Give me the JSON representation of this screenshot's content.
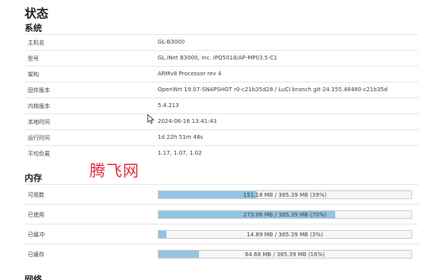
{
  "page_title": "状态",
  "system": {
    "title": "系统",
    "rows": [
      {
        "label": "主机名",
        "value": "GL-B3000"
      },
      {
        "label": "型号",
        "value": "GL.iNet B3000, Inc. IPQ5018/AP-MP03.5-C1"
      },
      {
        "label": "架构",
        "value": "ARMv8 Processor rev 4"
      },
      {
        "label": "固件版本",
        "value": "OpenWrt 19.07-SNAPSHOT r0-c21b35d28 / LuCI branch git-24.155.48480-c21b35d"
      },
      {
        "label": "内核版本",
        "value": "5.4.213"
      },
      {
        "label": "本地时间",
        "value": "2024-06-16 13:41:43"
      },
      {
        "label": "运行时间",
        "value": "1d 22h 51m 48s"
      },
      {
        "label": "平均负载",
        "value": "1.17, 1.07, 1.02"
      }
    ]
  },
  "memory": {
    "title": "内存",
    "rows": [
      {
        "label": "可用数",
        "value": "151.18 MB / 385.39 MB (39%)",
        "fraction": 0.39
      },
      {
        "label": "已使用",
        "value": "273.06 MB / 385.39 MB (70%)",
        "fraction": 0.7
      },
      {
        "label": "已缓冲",
        "value": "14.89 MB / 385.39 MB (3%)",
        "fraction": 0.03
      },
      {
        "label": "已缓存",
        "value": "64.68 MB / 385.39 MB (16%)",
        "fraction": 0.16
      }
    ]
  },
  "network": {
    "title": "网络"
  },
  "watermark": "腾飞网",
  "colors": {
    "bar_fill": "#93c4e3",
    "watermark": "#e0303a"
  }
}
